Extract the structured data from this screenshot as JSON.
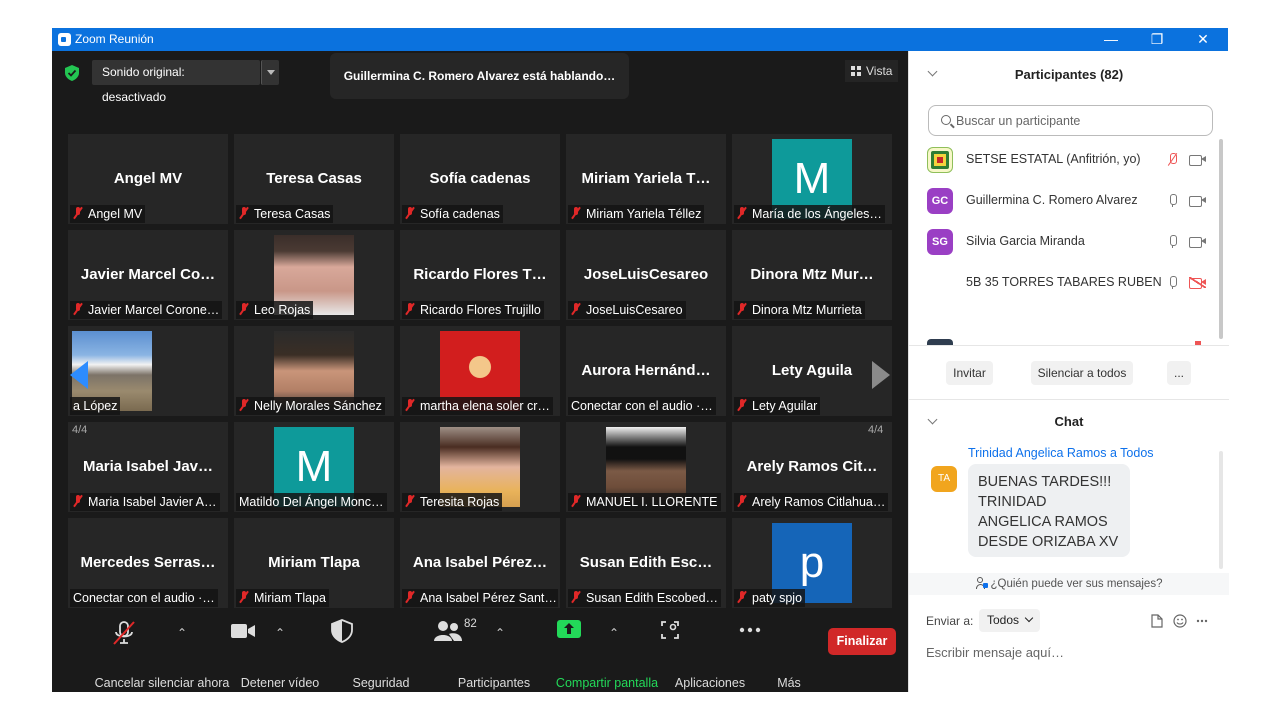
{
  "window": {
    "title": "Zoom Reunión",
    "min": "—",
    "restore": "❐",
    "close": "✕"
  },
  "top_bar": {
    "sound_button": "Sonido original: desactivado",
    "speaking_banner": "Guillermina C. Romero Alvarez está hablando…",
    "view_button": "Vista"
  },
  "gallery": {
    "page_left": "4/4",
    "page_right": "4/4",
    "tiles": [
      {
        "big": "Angel MV",
        "tag": "Angel MV",
        "muted": true
      },
      {
        "big": "Teresa Casas",
        "tag": "Teresa Casas",
        "muted": true
      },
      {
        "big": "Sofía cadenas",
        "tag": "Sofía cadenas",
        "muted": true
      },
      {
        "big": "Miriam Yariela T…",
        "tag": "Miriam Yariela Téllez",
        "muted": true
      },
      {
        "big": "",
        "tag": "María de los Ángeles…",
        "muted": true,
        "avatar_letter": "M",
        "avatar_color": "#0e9a9a"
      },
      {
        "big": "Javier Marcel Co…",
        "tag": "Javier Marcel Corone…",
        "muted": true
      },
      {
        "big": "",
        "tag": "Leo Rojas",
        "muted": true,
        "photo": "woman-glasses"
      },
      {
        "big": "Ricardo Flores T…",
        "tag": "Ricardo Flores Trujillo",
        "muted": true
      },
      {
        "big": "JoseLuisCesareo",
        "tag": "JoseLuisCesareo",
        "muted": true
      },
      {
        "big": "Dinora Mtz Mur…",
        "tag": "Dinora Mtz Murrieta",
        "muted": true
      },
      {
        "big": "",
        "tag": "a López",
        "muted": false,
        "photo": "volcano"
      },
      {
        "big": "",
        "tag": "Nelly Morales Sánchez",
        "muted": true,
        "photo": "woman-smile"
      },
      {
        "big": "",
        "tag": "martha elena soler cr…",
        "muted": true,
        "photo": "cartoon"
      },
      {
        "big": "Aurora  Hernánd…",
        "tag": "Conectar con el audio ·…",
        "muted": false
      },
      {
        "big": "Lety Aguila",
        "tag": "Lety Aguilar",
        "muted": true
      },
      {
        "big": "Maria Isabel Jav…",
        "tag": "Maria Isabel Javier A…",
        "muted": true
      },
      {
        "big": "",
        "tag": "Matildo Del Ángel Monc…",
        "muted": false,
        "avatar_letter": "M",
        "avatar_color": "#0e9a9a"
      },
      {
        "big": "",
        "tag": "Teresita Rojas",
        "muted": true,
        "photo": "young-woman"
      },
      {
        "big": "",
        "tag": "MANUEL I. LLORENTE",
        "muted": true,
        "photo": "hat-person"
      },
      {
        "big": "Arely Ramos Cit…",
        "tag": "Arely Ramos Citlahua…",
        "muted": true
      },
      {
        "big": "Mercedes  Serras…",
        "tag": "Conectar con el audio ·…",
        "muted": false
      },
      {
        "big": "Miriam Tlapa",
        "tag": "Miriam Tlapa",
        "muted": true
      },
      {
        "big": "Ana Isabel Pérez…",
        "tag": "Ana Isabel Pérez Sant…",
        "muted": true
      },
      {
        "big": "Susan Edith Esc…",
        "tag": "Susan Edith Escobed…",
        "muted": true
      },
      {
        "big": "",
        "tag": "paty spjo",
        "muted": true,
        "avatar_letter": "p",
        "avatar_color": "#1565b8"
      }
    ]
  },
  "toolbar": {
    "unmute": "Cancelar silenciar ahora",
    "video": "Detener vídeo",
    "security": "Seguridad",
    "participants": "Participantes",
    "participants_count": "82",
    "share": "Compartir pantalla",
    "apps": "Aplicaciones",
    "more": "Más",
    "end": "Finalizar",
    "share_color": "#23d959"
  },
  "participants": {
    "title": "Participantes (82)",
    "search_placeholder": "Buscar un participante",
    "list": [
      {
        "initials": "",
        "name": "SETSE ESTATAL (Anfitrión, yo)",
        "color": "#ffffff"
      },
      {
        "initials": "GC",
        "name": "Guillermina C. Romero Alvarez",
        "color": "#9a3fc4"
      },
      {
        "initials": "SG",
        "name": "Silvia Garcia Miranda",
        "color": "#9a3fc4"
      },
      {
        "initials": "",
        "name": "5B 35 TORRES TABARES RUBEN …",
        "color": "#ffffff"
      }
    ],
    "invite": "Invitar",
    "mute_all": "Silenciar a todos",
    "more": "..."
  },
  "chat": {
    "title": "Chat",
    "from": "Trinidad Angelica Ramos a Todos",
    "avatar": "TA",
    "message": "BUENAS TARDES!!! TRINIDAD ANGELICA RAMOS DESDE ORIZABA XV",
    "who_sees": "¿Quién puede ver sus mensajes?",
    "send_to_label": "Enviar a:",
    "send_to_value": "Todos",
    "input_placeholder": "Escribir mensaje aquí…"
  }
}
